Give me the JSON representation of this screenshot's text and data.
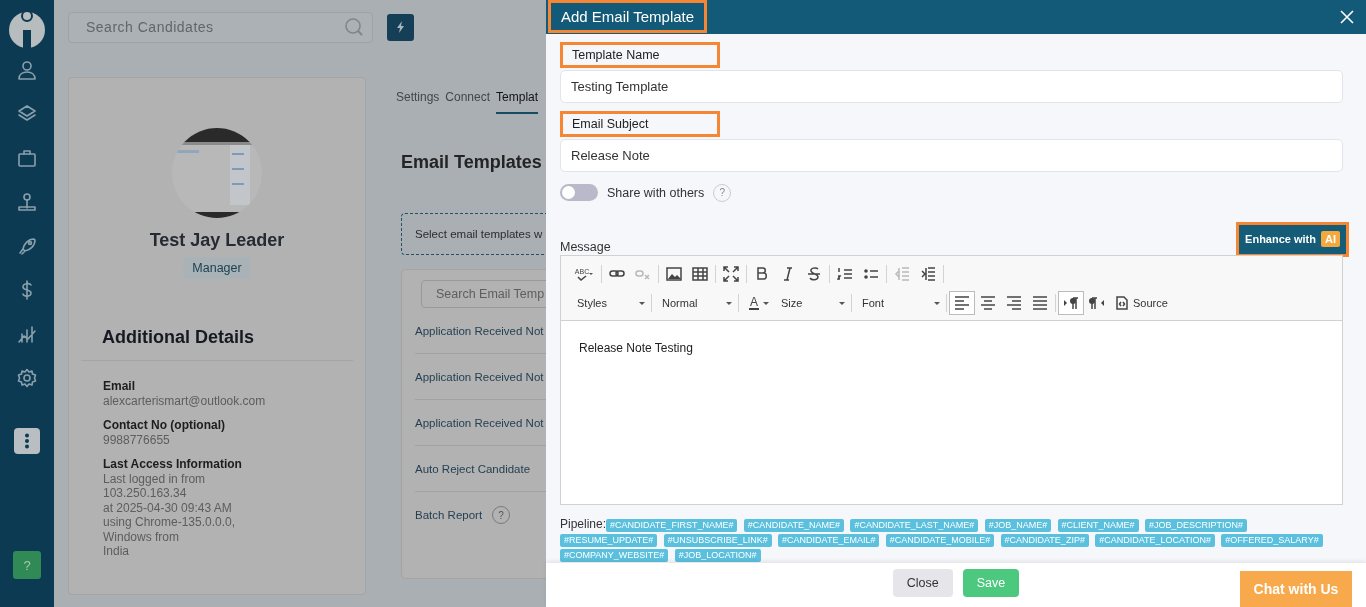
{
  "sidebar": {
    "help_label": "?"
  },
  "topbar": {
    "search_placeholder": "Search Candidates"
  },
  "profile": {
    "name": "Test Jay Leader",
    "role": "Manager",
    "section_title": "Additional Details",
    "details": [
      {
        "label": "Email",
        "lines": [
          "alexcarterismart@outlook.com"
        ]
      },
      {
        "label": "Contact No (optional)",
        "lines": [
          "9988776655"
        ]
      },
      {
        "label": "Last Access Information",
        "lines": [
          "Last logged in from",
          "103.250.163.34",
          "at 2025-04-30 09:43 AM",
          "using Chrome-135.0.0.0,",
          "Windows from",
          "India"
        ]
      }
    ]
  },
  "tabs": [
    {
      "label": "Settings",
      "selected": false
    },
    {
      "label": "Connect",
      "selected": false
    },
    {
      "label": "Templat",
      "selected": true
    }
  ],
  "templates": {
    "title": "Email Templates",
    "notice": "Select email templates w",
    "search_placeholder": "Search Email Temp",
    "rows": [
      {
        "label": "Application Received Not"
      },
      {
        "label": "Application Received Not"
      },
      {
        "label": "Application Received Not"
      },
      {
        "label": "Auto Reject Candidate"
      },
      {
        "label": "Batch Report",
        "help": "?"
      }
    ]
  },
  "modal": {
    "title": "Add Email Template",
    "title_highlighted": true,
    "fields": [
      {
        "label": "Template Name",
        "value": "Testing Template",
        "highlighted": true
      },
      {
        "label": "Email Subject",
        "value": "Release Note",
        "highlighted": true
      }
    ],
    "share": {
      "label": "Share with others",
      "on": false,
      "help": "?"
    },
    "message_label": "Message",
    "enhance": {
      "label": "Enhance with",
      "badge": "AI",
      "highlighted": true
    },
    "toolbar": {
      "spellcheck_label": "ABC",
      "text_color_label": "A",
      "row1": [
        {
          "disabled": false
        },
        {
          "disabled": false
        },
        {
          "disabled": true
        },
        {
          "disabled": false
        },
        {
          "disabled": false
        },
        {
          "disabled": false
        },
        {
          "disabled": false
        },
        {
          "disabled": false
        },
        {
          "disabled": false
        },
        {
          "disabled": false
        },
        {
          "disabled": false
        },
        {
          "disabled": true
        },
        {
          "disabled": false
        }
      ],
      "dropdowns": [
        "Styles",
        "Normal",
        "Size",
        "Font"
      ],
      "align": [
        {
          "selected": true
        },
        {
          "selected": false
        },
        {
          "selected": false
        },
        {
          "selected": false
        }
      ],
      "direction": [
        {
          "selected": true
        },
        {
          "selected": false
        }
      ],
      "source_label": "Source"
    },
    "content": "Release Note Testing",
    "pipeline_label": "Pipeline:",
    "tags": [
      "#CANDIDATE_FIRST_NAME#",
      "#CANDIDATE_NAME#",
      "#CANDIDATE_LAST_NAME#",
      "#JOB_NAME#",
      "#CLIENT_NAME#",
      "#JOB_DESCRIPTION#",
      "#RESUME_UPDATE#",
      "#UNSUBSCRIBE_LINK#",
      "#CANDIDATE_EMAIL#",
      "#CANDIDATE_MOBILE#",
      "#CANDIDATE_ZIP#",
      "#CANDIDATE_LOCATION#",
      "#OFFERED_SALARY#",
      "#COMPANY_WEBSITE#",
      "#JOB_LOCATION#"
    ],
    "buttons": [
      {
        "label": "Close",
        "kind": "secondary"
      },
      {
        "label": "Save",
        "kind": "primary"
      }
    ]
  },
  "chat": {
    "label": "Chat with Us"
  }
}
